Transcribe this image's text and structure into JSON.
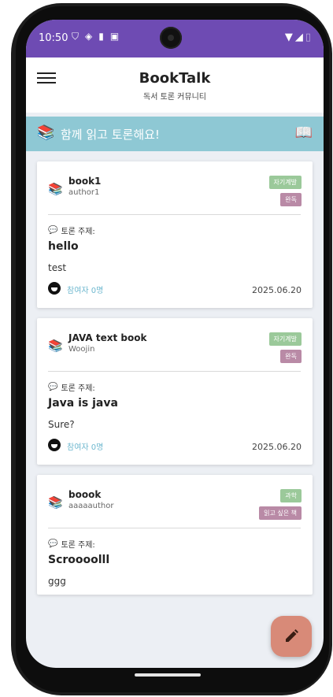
{
  "status": {
    "time": "10:50",
    "left_icons": [
      "shield-icon",
      "signal-dot-icon",
      "sd-card-icon",
      "notification-icon"
    ],
    "right_icons": [
      "wifi-icon",
      "cell-signal-icon",
      "battery-icon"
    ]
  },
  "appbar": {
    "title": "BookTalk",
    "subtitle": "독서 토론 커뮤니티"
  },
  "banner": {
    "text": "함께 읽고 토론해요!",
    "color": "#8ec8d4"
  },
  "colors": {
    "status_bar": "#6e4bb3",
    "tag_green": "#9bc99a",
    "tag_purple": "#b98aa6",
    "participant_text": "#6fb8cf",
    "fab": "#d88a78"
  },
  "cards": [
    {
      "title": "book1",
      "author": "author1",
      "tag1": "자기계발",
      "tag2": "완독",
      "topic_label": "토론 주제:",
      "topic_title": "hello",
      "topic_body": "test",
      "participants": "참여자 0명",
      "date": "2025.06.20"
    },
    {
      "title": "JAVA text book",
      "author": "Woojin",
      "tag1": "자기계발",
      "tag2": "완독",
      "topic_label": "토론 주제:",
      "topic_title": "Java is java",
      "topic_body": "Sure?",
      "participants": "참여자 0명",
      "date": "2025.06.20"
    },
    {
      "title": "boook",
      "author": "aaaaauthor",
      "tag1": "과학",
      "tag2": "읽고 싶은 책",
      "topic_label": "토론 주제:",
      "topic_title": "Scroooolll",
      "topic_body": "ggg"
    }
  ]
}
